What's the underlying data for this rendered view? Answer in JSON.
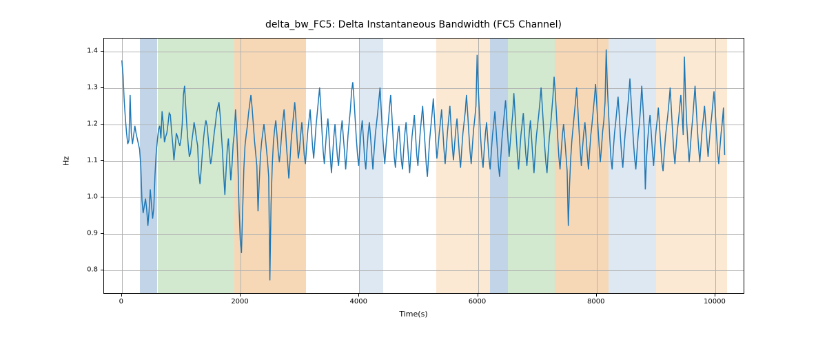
{
  "chart_data": {
    "type": "line",
    "title": "delta_bw_FC5: Delta Instantaneous Bandwidth (FC5 Channel)",
    "xlabel": "Time(s)",
    "ylabel": "Hz",
    "xlim": [
      -300,
      10500
    ],
    "ylim": [
      0.735,
      1.435
    ],
    "yticks": [
      0.8,
      0.9,
      1.0,
      1.1,
      1.2,
      1.3,
      1.4
    ],
    "xticks": [
      0,
      2000,
      4000,
      6000,
      8000,
      10000
    ],
    "bands": [
      {
        "x0": 300,
        "x1": 600,
        "color": "#c2d5e8"
      },
      {
        "x0": 600,
        "x1": 1900,
        "color": "#d2e8cf"
      },
      {
        "x0": 1900,
        "x1": 3100,
        "color": "#f7d8b6"
      },
      {
        "x0": 4000,
        "x1": 4400,
        "color": "#dde8f3"
      },
      {
        "x0": 4400,
        "x1": 5300,
        "color": "#ffffff"
      },
      {
        "x0": 5300,
        "x1": 6200,
        "color": "#fbe9d3"
      },
      {
        "x0": 6200,
        "x1": 6500,
        "color": "#c2d5e8"
      },
      {
        "x0": 6500,
        "x1": 7300,
        "color": "#d2e8cf"
      },
      {
        "x0": 7300,
        "x1": 8200,
        "color": "#f7d8b6"
      },
      {
        "x0": 8200,
        "x1": 9000,
        "color": "#dde8f3"
      },
      {
        "x0": 9000,
        "x1": 10200,
        "color": "#fbe9d3"
      }
    ],
    "line_color": "#1f77b4",
    "series": [
      {
        "name": "delta_bw_FC5",
        "x_step": 20,
        "x_start": 0,
        "values": [
          1.375,
          1.335,
          1.265,
          1.215,
          1.175,
          1.145,
          1.155,
          1.28,
          1.175,
          1.145,
          1.17,
          1.195,
          1.175,
          1.16,
          1.145,
          1.13,
          1.085,
          0.99,
          0.955,
          0.975,
          0.995,
          0.965,
          0.92,
          0.96,
          1.02,
          0.98,
          0.94,
          0.97,
          1.06,
          1.12,
          1.155,
          1.185,
          1.195,
          1.16,
          1.235,
          1.2,
          1.15,
          1.165,
          1.175,
          1.2,
          1.23,
          1.225,
          1.18,
          1.145,
          1.1,
          1.135,
          1.175,
          1.165,
          1.15,
          1.14,
          1.16,
          1.2,
          1.28,
          1.305,
          1.245,
          1.19,
          1.145,
          1.11,
          1.12,
          1.15,
          1.175,
          1.205,
          1.185,
          1.16,
          1.14,
          1.065,
          1.035,
          1.075,
          1.12,
          1.16,
          1.19,
          1.21,
          1.195,
          1.16,
          1.12,
          1.09,
          1.11,
          1.145,
          1.175,
          1.2,
          1.23,
          1.245,
          1.26,
          1.225,
          1.175,
          1.125,
          1.06,
          1.005,
          1.07,
          1.13,
          1.16,
          1.1,
          1.045,
          1.085,
          1.145,
          1.175,
          1.24,
          1.18,
          1.095,
          0.965,
          0.88,
          0.845,
          0.96,
          1.075,
          1.14,
          1.17,
          1.195,
          1.23,
          1.255,
          1.28,
          1.245,
          1.2,
          1.155,
          1.12,
          1.085,
          0.96,
          1.04,
          1.11,
          1.15,
          1.175,
          1.2,
          1.17,
          1.135,
          1.1,
          1.055,
          0.77,
          0.98,
          1.085,
          1.15,
          1.185,
          1.21,
          1.17,
          1.125,
          1.095,
          1.13,
          1.175,
          1.21,
          1.24,
          1.195,
          1.14,
          1.095,
          1.05,
          1.1,
          1.155,
          1.19,
          1.225,
          1.26,
          1.215,
          1.155,
          1.105,
          1.13,
          1.17,
          1.205,
          1.165,
          1.115,
          1.09,
          1.135,
          1.18,
          1.21,
          1.24,
          1.19,
          1.14,
          1.105,
          1.15,
          1.195,
          1.23,
          1.265,
          1.3,
          1.245,
          1.18,
          1.125,
          1.09,
          1.14,
          1.185,
          1.215,
          1.165,
          1.11,
          1.065,
          1.115,
          1.165,
          1.2,
          1.155,
          1.11,
          1.085,
          1.135,
          1.18,
          1.21,
          1.165,
          1.125,
          1.075,
          1.12,
          1.17,
          1.205,
          1.24,
          1.29,
          1.315,
          1.27,
          1.215,
          1.16,
          1.115,
          1.085,
          1.135,
          1.18,
          1.21,
          1.16,
          1.105,
          1.075,
          1.13,
          1.175,
          1.205,
          1.165,
          1.12,
          1.075,
          1.125,
          1.17,
          1.2,
          1.23,
          1.265,
          1.3,
          1.24,
          1.18,
          1.13,
          1.09,
          1.135,
          1.175,
          1.205,
          1.245,
          1.28,
          1.225,
          1.165,
          1.11,
          1.08,
          1.13,
          1.175,
          1.195,
          1.145,
          1.1,
          1.075,
          1.13,
          1.175,
          1.205,
          1.16,
          1.11,
          1.065,
          1.115,
          1.165,
          1.195,
          1.225,
          1.17,
          1.115,
          1.085,
          1.135,
          1.18,
          1.215,
          1.25,
          1.195,
          1.145,
          1.09,
          1.055,
          1.11,
          1.16,
          1.195,
          1.23,
          1.27,
          1.215,
          1.155,
          1.105,
          1.135,
          1.175,
          1.205,
          1.24,
          1.185,
          1.13,
          1.09,
          1.135,
          1.18,
          1.215,
          1.25,
          1.195,
          1.14,
          1.1,
          1.145,
          1.185,
          1.215,
          1.165,
          1.115,
          1.08,
          1.13,
          1.175,
          1.205,
          1.235,
          1.28,
          1.23,
          1.175,
          1.125,
          1.09,
          1.14,
          1.185,
          1.215,
          1.25,
          1.39,
          1.295,
          1.225,
          1.16,
          1.11,
          1.08,
          1.13,
          1.175,
          1.205,
          1.155,
          1.105,
          1.075,
          1.125,
          1.17,
          1.2,
          1.235,
          1.185,
          1.135,
          1.085,
          1.055,
          1.11,
          1.16,
          1.195,
          1.23,
          1.265,
          1.215,
          1.16,
          1.11,
          1.15,
          1.19,
          1.225,
          1.285,
          1.23,
          1.17,
          1.115,
          1.075,
          1.125,
          1.17,
          1.2,
          1.23,
          1.175,
          1.12,
          1.085,
          1.13,
          1.175,
          1.21,
          1.16,
          1.11,
          1.065,
          1.115,
          1.165,
          1.195,
          1.225,
          1.26,
          1.3,
          1.25,
          1.195,
          1.14,
          1.095,
          1.065,
          1.12,
          1.165,
          1.195,
          1.235,
          1.275,
          1.33,
          1.285,
          1.225,
          1.165,
          1.11,
          1.075,
          1.125,
          1.17,
          1.2,
          1.16,
          1.115,
          1.07,
          0.92,
          1.03,
          1.105,
          1.155,
          1.19,
          1.225,
          1.26,
          1.3,
          1.245,
          1.185,
          1.13,
          1.085,
          1.135,
          1.175,
          1.205,
          1.165,
          1.115,
          1.075,
          1.125,
          1.17,
          1.2,
          1.235,
          1.27,
          1.31,
          1.255,
          1.195,
          1.14,
          1.095,
          1.135,
          1.18,
          1.21,
          1.26,
          1.405,
          1.3,
          1.23,
          1.16,
          1.105,
          1.075,
          1.13,
          1.175,
          1.205,
          1.24,
          1.275,
          1.225,
          1.165,
          1.115,
          1.08,
          1.13,
          1.175,
          1.205,
          1.24,
          1.28,
          1.325,
          1.265,
          1.205,
          1.15,
          1.105,
          1.075,
          1.125,
          1.17,
          1.2,
          1.245,
          1.305,
          1.25,
          1.19,
          1.02,
          1.105,
          1.155,
          1.195,
          1.225,
          1.175,
          1.125,
          1.085,
          1.135,
          1.18,
          1.21,
          1.245,
          1.195,
          1.145,
          1.095,
          1.07,
          1.12,
          1.165,
          1.195,
          1.225,
          1.26,
          1.3,
          1.24,
          1.18,
          1.125,
          1.09,
          1.135,
          1.18,
          1.21,
          1.245,
          1.28,
          1.23,
          1.17,
          1.385,
          1.275,
          1.2,
          1.145,
          1.095,
          1.135,
          1.18,
          1.215,
          1.26,
          1.305,
          1.245,
          1.185,
          1.135,
          1.095,
          1.14,
          1.185,
          1.215,
          1.25,
          1.205,
          1.155,
          1.11,
          1.15,
          1.19,
          1.22,
          1.255,
          1.29,
          1.24,
          1.18,
          1.125,
          1.09,
          1.135,
          1.175,
          1.205,
          1.245,
          1.115
        ]
      }
    ]
  }
}
